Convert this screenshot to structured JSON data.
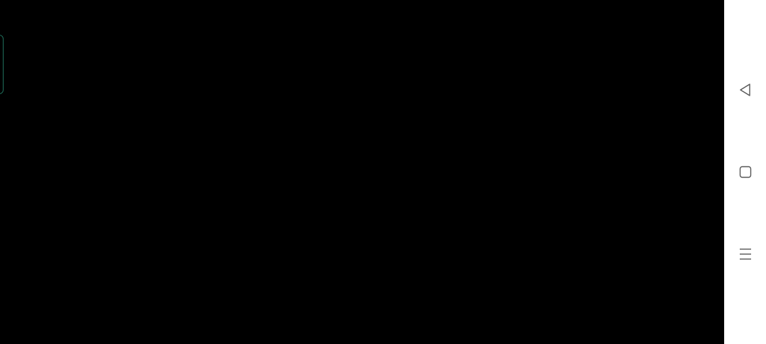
{
  "colors": {
    "content_background": "#000000",
    "nav_bar_background": "#ffffff",
    "nav_icon": "#555555",
    "edge_handle_border": "#1f6f5c"
  },
  "navigation_bar": {
    "buttons": [
      {
        "icon": "back-triangle-icon"
      },
      {
        "icon": "home-square-icon"
      },
      {
        "icon": "menu-lines-icon"
      }
    ]
  }
}
